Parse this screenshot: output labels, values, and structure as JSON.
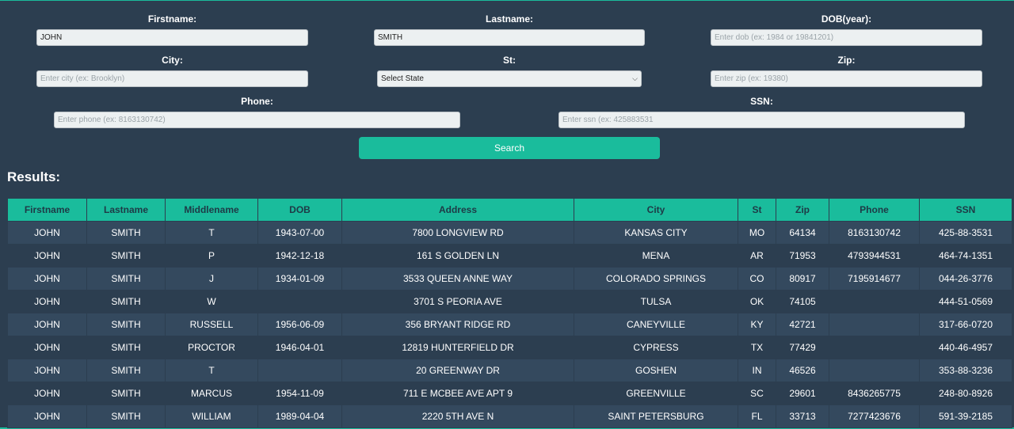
{
  "form": {
    "firstname": {
      "label": "Firstname:",
      "value": "JOHN",
      "placeholder": ""
    },
    "lastname": {
      "label": "Lastname:",
      "value": "SMITH",
      "placeholder": ""
    },
    "dob": {
      "label": "DOB(year):",
      "value": "",
      "placeholder": "Enter dob (ex: 1984 or 19841201)"
    },
    "city": {
      "label": "City:",
      "value": "",
      "placeholder": "Enter city (ex: Brooklyn)"
    },
    "state": {
      "label": "St:",
      "value": "Select State"
    },
    "zip": {
      "label": "Zip:",
      "value": "",
      "placeholder": "Enter zip (ex: 19380)"
    },
    "phone": {
      "label": "Phone:",
      "value": "",
      "placeholder": "Enter phone (ex: 8163130742)"
    },
    "ssn": {
      "label": "SSN:",
      "value": "",
      "placeholder": "Enter ssn (ex: 425883531"
    },
    "search_label": "Search"
  },
  "results": {
    "heading": "Results:",
    "columns": [
      "Firstname",
      "Lastname",
      "Middlename",
      "DOB",
      "Address",
      "City",
      "St",
      "Zip",
      "Phone",
      "SSN"
    ],
    "rows": [
      [
        "JOHN",
        "SMITH",
        "T",
        "1943-07-00",
        "7800 LONGVIEW RD",
        "KANSAS CITY",
        "MO",
        "64134",
        "8163130742",
        "425-88-3531"
      ],
      [
        "JOHN",
        "SMITH",
        "P",
        "1942-12-18",
        "161 S GOLDEN LN",
        "MENA",
        "AR",
        "71953",
        "4793944531",
        "464-74-1351"
      ],
      [
        "JOHN",
        "SMITH",
        "J",
        "1934-01-09",
        "3533 QUEEN ANNE WAY",
        "COLORADO SPRINGS",
        "CO",
        "80917",
        "7195914677",
        "044-26-3776"
      ],
      [
        "JOHN",
        "SMITH",
        "W",
        "",
        "3701 S PEORIA AVE",
        "TULSA",
        "OK",
        "74105",
        "",
        "444-51-0569"
      ],
      [
        "JOHN",
        "SMITH",
        "RUSSELL",
        "1956-06-09",
        "356 BRYANT RIDGE RD",
        "CANEYVILLE",
        "KY",
        "42721",
        "",
        "317-66-0720"
      ],
      [
        "JOHN",
        "SMITH",
        "PROCTOR",
        "1946-04-01",
        "12819 HUNTERFIELD DR",
        "CYPRESS",
        "TX",
        "77429",
        "",
        "440-46-4957"
      ],
      [
        "JOHN",
        "SMITH",
        "T",
        "",
        "20 GREENWAY DR",
        "GOSHEN",
        "IN",
        "46526",
        "",
        "353-88-3236"
      ],
      [
        "JOHN",
        "SMITH",
        "MARCUS",
        "1954-11-09",
        "711 E MCBEE AVE APT 9",
        "GREENVILLE",
        "SC",
        "29601",
        "8436265775",
        "248-80-8926"
      ],
      [
        "JOHN",
        "SMITH",
        "WILLIAM",
        "1989-04-04",
        "2220 5TH AVE N",
        "SAINT PETERSBURG",
        "FL",
        "33713",
        "7277423676",
        "591-39-2185"
      ]
    ]
  },
  "colors": {
    "accent": "#1abc9c",
    "background": "#2c3e50",
    "row_alt": "#34495e"
  }
}
